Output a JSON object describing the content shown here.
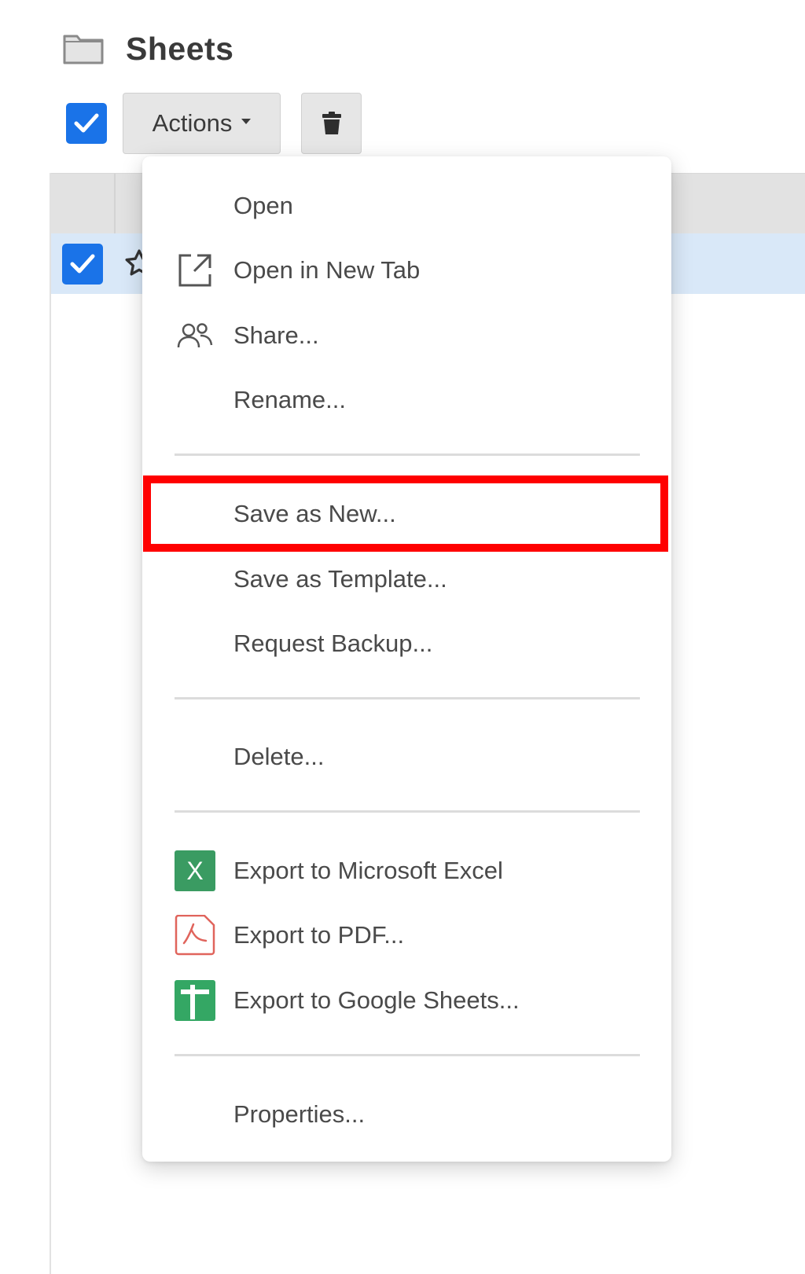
{
  "header": {
    "title": "Sheets",
    "icon": "folder-icon"
  },
  "toolbar": {
    "select_all_checked": true,
    "actions_label": "Actions",
    "delete_icon": "trash-icon"
  },
  "table": {
    "rows": [
      {
        "selected": true,
        "starred": false
      }
    ]
  },
  "colors": {
    "accent": "#1a73e8",
    "highlight": "#ff0000",
    "selected_row": "#d9e8f8",
    "excel": "#3a9b62",
    "pdf": "#e0645c",
    "google_sheets": "#34a764"
  },
  "menu": {
    "groups": [
      [
        {
          "label": "Open",
          "icon": null
        },
        {
          "label": "Open in New Tab",
          "icon": "external-link-icon"
        },
        {
          "label": "Share...",
          "icon": "users-icon"
        },
        {
          "label": "Rename...",
          "icon": null
        }
      ],
      [
        {
          "label": "Save as New...",
          "icon": null,
          "highlighted": true
        },
        {
          "label": "Save as Template...",
          "icon": null
        },
        {
          "label": "Request Backup...",
          "icon": null
        }
      ],
      [
        {
          "label": "Delete...",
          "icon": null
        }
      ],
      [
        {
          "label": "Export to Microsoft Excel",
          "icon": "excel-icon"
        },
        {
          "label": "Export to PDF...",
          "icon": "pdf-icon"
        },
        {
          "label": "Export to Google Sheets...",
          "icon": "google-sheets-icon"
        }
      ],
      [
        {
          "label": "Properties...",
          "icon": null
        }
      ]
    ]
  }
}
